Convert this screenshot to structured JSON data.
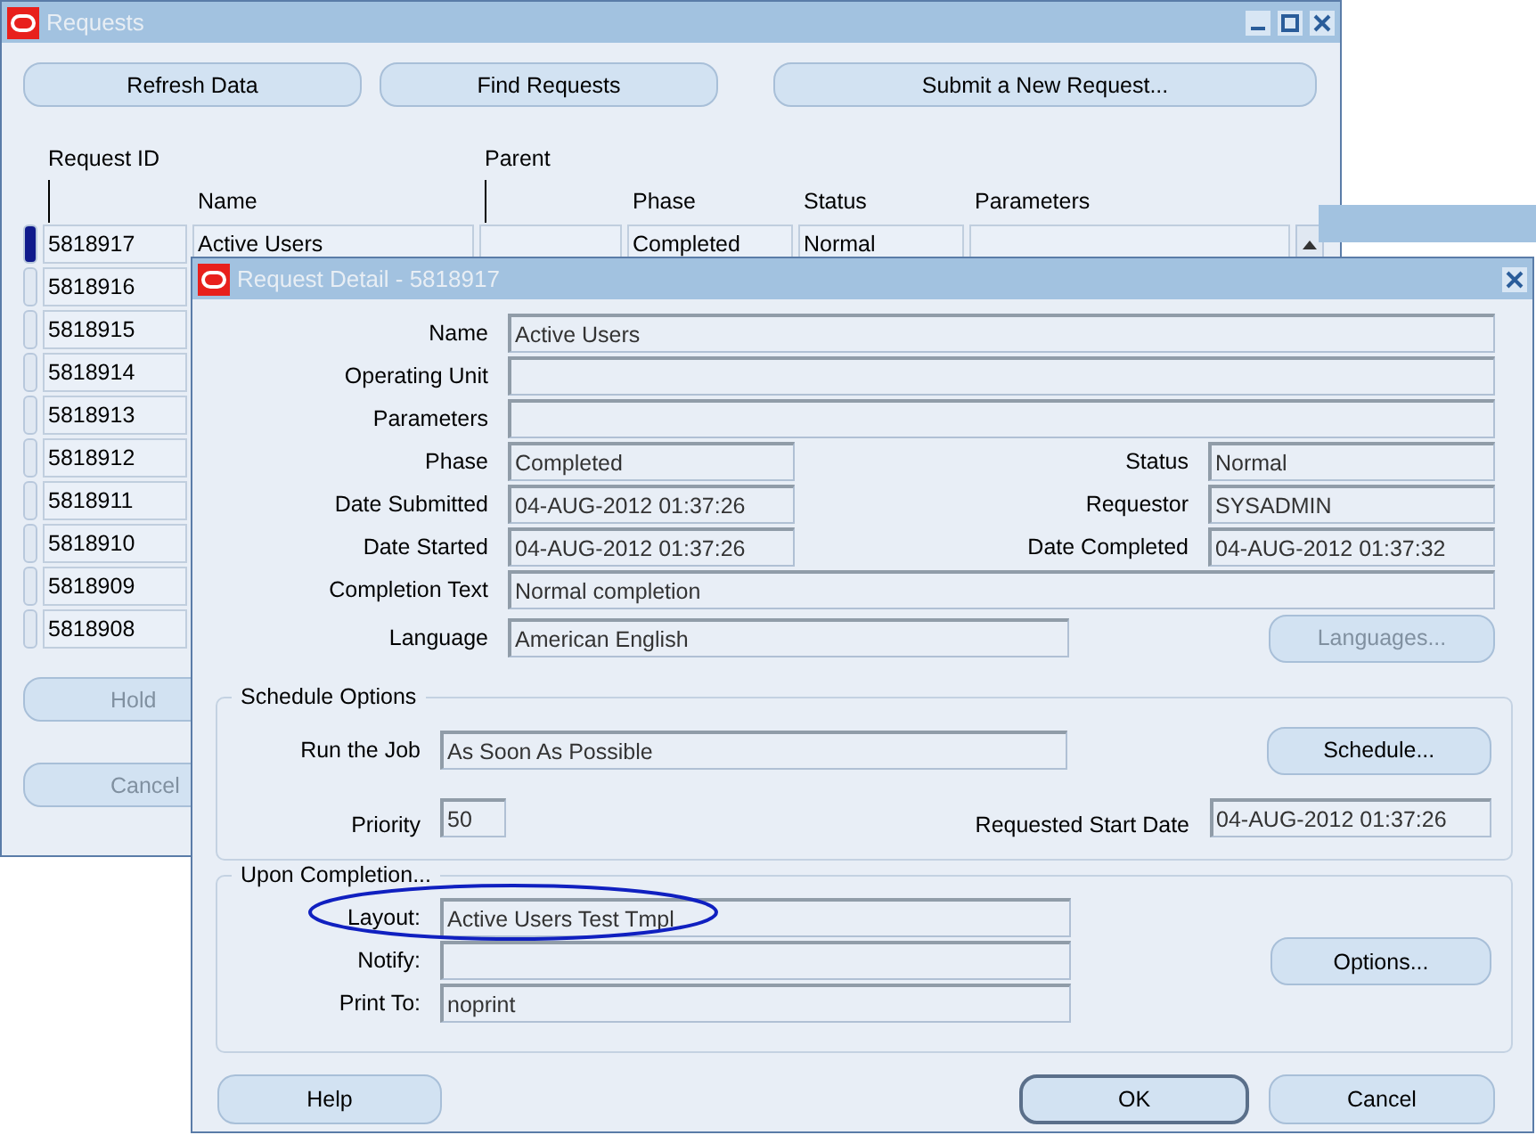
{
  "requests_window": {
    "title": "Requests",
    "toolbar": [
      {
        "label": "Refresh Data"
      },
      {
        "label": "Find Requests"
      },
      {
        "label": "Submit a New Request..."
      }
    ],
    "columns_top": [
      "Request ID",
      "Parent"
    ],
    "columns_bottom": [
      "Name",
      "Phase",
      "Status",
      "Parameters"
    ],
    "rows": [
      {
        "id": "5818917",
        "name": "Active Users",
        "phase": "Completed",
        "status": "Normal",
        "selected": true
      },
      {
        "id": "5818916",
        "selected": false
      },
      {
        "id": "5818915",
        "selected": false
      },
      {
        "id": "5818914",
        "selected": false
      },
      {
        "id": "5818913",
        "selected": false
      },
      {
        "id": "5818912",
        "selected": false
      },
      {
        "id": "5818911",
        "selected": false
      },
      {
        "id": "5818910",
        "selected": false
      },
      {
        "id": "5818909",
        "selected": false
      },
      {
        "id": "5818908",
        "selected": false
      }
    ],
    "bottom_buttons": [
      "Hold",
      "Cancel"
    ]
  },
  "detail_dialog": {
    "title": "Request Detail - 5818917",
    "rows": [
      {
        "kind": "full",
        "label": "Name",
        "value": "Active Users"
      },
      {
        "kind": "full",
        "label": "Operating Unit"
      },
      {
        "kind": "full",
        "label": "Parameters"
      },
      {
        "kind": "pair",
        "label": "Phase",
        "value": "Completed",
        "right_label": "Status",
        "right_value": "Normal"
      },
      {
        "kind": "pair",
        "label": "Date Submitted",
        "value": "04-AUG-2012 01:37:26",
        "right_label": "Requestor",
        "right_value": "SYSADMIN"
      },
      {
        "kind": "pair",
        "label": "Date Started",
        "value": "04-AUG-2012 01:37:26",
        "right_label": "Date Completed",
        "right_value": "04-AUG-2012 01:37:32"
      },
      {
        "kind": "full",
        "label": "Completion Text",
        "value": "Normal completion"
      },
      {
        "kind": "button",
        "label": "Language",
        "value": "American English",
        "button": "Languages...",
        "disabled": true
      }
    ],
    "schedule": {
      "title": "Schedule Options",
      "run_label": "Run the Job",
      "run_value": "As Soon As Possible",
      "button": "Schedule...",
      "priority_label": "Priority",
      "priority_value": "50",
      "start_label": "Requested Start Date",
      "start_value": "04-AUG-2012 01:37:26"
    },
    "completion": {
      "title": "Upon Completion...",
      "fields": [
        {
          "label": "Layout:",
          "value": "Active Users Test Tmpl",
          "highlighted": true
        },
        {
          "label": "Notify:",
          "highlighted": false
        },
        {
          "label": "Print To:",
          "value": "noprint",
          "highlighted": false
        }
      ],
      "button": "Options..."
    },
    "footer": [
      {
        "label": "Help",
        "default": false
      },
      {
        "label": "OK",
        "default": true
      },
      {
        "label": "Cancel",
        "default": false
      }
    ]
  }
}
